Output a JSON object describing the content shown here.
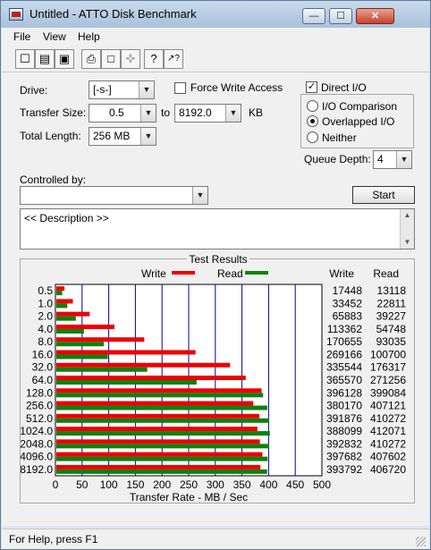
{
  "window": {
    "title": "Untitled - ATTO Disk Benchmark",
    "controls": {
      "minimize": "—",
      "maximize": "☐",
      "close": "✕"
    }
  },
  "menu": {
    "items": [
      "File",
      "View",
      "Help"
    ]
  },
  "toolbar": {
    "buttons": [
      {
        "name": "new-file-icon",
        "glyph": "☐"
      },
      {
        "name": "open-folder-icon",
        "glyph": "▤"
      },
      {
        "name": "save-icon",
        "glyph": "▣"
      },
      {
        "name": "print-icon",
        "glyph": "⎙"
      },
      {
        "name": "print-preview-icon",
        "glyph": "□"
      },
      {
        "name": "move-icon",
        "glyph": "✜"
      },
      {
        "name": "help-icon",
        "glyph": "?"
      },
      {
        "name": "context-help-icon",
        "glyph": "↗?"
      }
    ]
  },
  "settings": {
    "drive_label": "Drive:",
    "drive_value": "[-s-]",
    "force_write_label": "Force Write Access",
    "force_write_checked": false,
    "direct_io_label": "Direct I/O",
    "direct_io_checked": true,
    "transfer_size_label": "Transfer Size:",
    "transfer_from": "0.5",
    "to_label": "to",
    "transfer_to": "8192.0",
    "kb_label": "KB",
    "total_length_label": "Total Length:",
    "total_length_value": "256 MB",
    "io_options": [
      {
        "label": "I/O Comparison",
        "selected": false
      },
      {
        "label": "Overlapped I/O",
        "selected": true
      },
      {
        "label": "Neither",
        "selected": false
      }
    ],
    "queue_depth_label": "Queue Depth:",
    "queue_depth_value": "4",
    "controlled_by_label": "Controlled by:",
    "controlled_by_value": "",
    "start_label": "Start",
    "description_text": "<< Description >>"
  },
  "chart_data": {
    "type": "bar",
    "orientation": "horizontal",
    "title": "Test Results",
    "xlabel": "Transfer Rate - MB / Sec",
    "xlim": [
      0,
      500
    ],
    "xticks": [
      0,
      50,
      100,
      150,
      200,
      250,
      300,
      350,
      400,
      450,
      500
    ],
    "categories": [
      "0.5",
      "1.0",
      "2.0",
      "4.0",
      "8.0",
      "16.0",
      "32.0",
      "64.0",
      "128.0",
      "256.0",
      "512.0",
      "1024.0",
      "2048.0",
      "4096.0",
      "8192.0"
    ],
    "legend": [
      {
        "label": "Write",
        "color": "#ee0000"
      },
      {
        "label": "Read",
        "color": "#108010"
      }
    ],
    "column_headers": [
      "Write",
      "Read"
    ],
    "series": [
      {
        "name": "Write",
        "color": "#ee0000",
        "values_kbs": [
          17448,
          33452,
          65883,
          113362,
          170655,
          269166,
          335544,
          365570,
          396128,
          380170,
          391876,
          388099,
          392832,
          397682,
          393792
        ],
        "values_mbs": [
          17.0,
          32.7,
          64.3,
          110.7,
          166.7,
          262.9,
          327.7,
          357.0,
          386.8,
          371.3,
          382.7,
          379.0,
          383.6,
          388.4,
          384.6
        ]
      },
      {
        "name": "Read",
        "color": "#108010",
        "values_kbs": [
          13118,
          22811,
          39227,
          54748,
          93035,
          100700,
          176317,
          271256,
          399084,
          407121,
          410272,
          412071,
          410272,
          407602,
          406720
        ],
        "values_mbs": [
          12.8,
          22.3,
          38.3,
          53.5,
          90.9,
          98.3,
          172.2,
          264.9,
          389.7,
          397.6,
          400.7,
          402.4,
          400.7,
          398.0,
          397.2
        ]
      }
    ]
  },
  "status": {
    "text": "For Help, press F1"
  }
}
